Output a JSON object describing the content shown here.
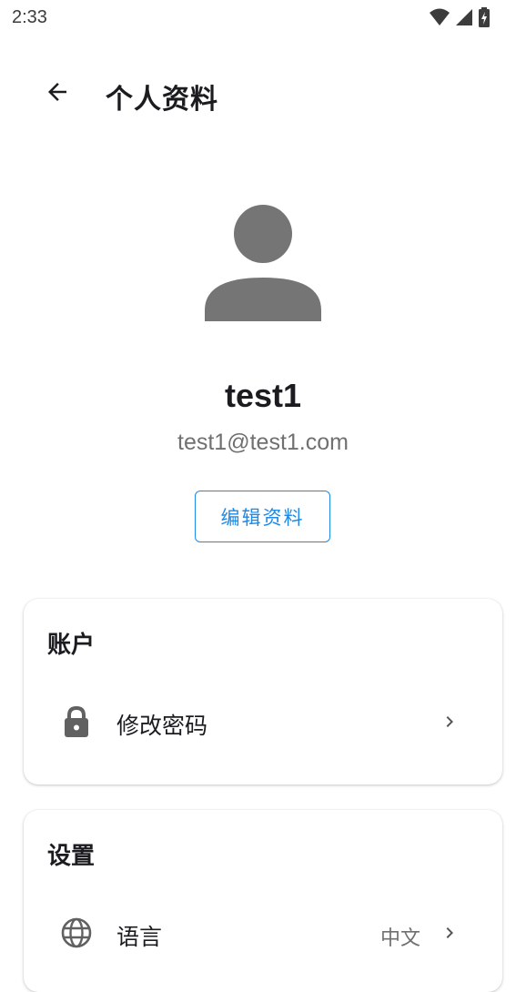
{
  "status_bar": {
    "time": "2:33",
    "icons": [
      "wifi-icon",
      "signal-icon",
      "battery-icon"
    ]
  },
  "app_bar": {
    "title": "个人资料",
    "back_icon": "arrow-back-icon"
  },
  "profile": {
    "avatar_icon": "person-icon",
    "username": "test1",
    "email": "test1@test1.com",
    "edit_button_label": "编辑资料"
  },
  "account_section": {
    "title": "账户",
    "items": [
      {
        "icon": "lock-icon",
        "label": "修改密码",
        "value": "",
        "chevron": "chevron-right-icon"
      }
    ]
  },
  "settings_section": {
    "title": "设置",
    "items": [
      {
        "icon": "globe-icon",
        "label": "语言",
        "value": "中文",
        "chevron": "chevron-right-icon"
      }
    ]
  },
  "colors": {
    "accent": "#1e88e5",
    "avatar": "#757575",
    "text_primary": "#1c1b1f",
    "text_secondary": "#707070"
  }
}
